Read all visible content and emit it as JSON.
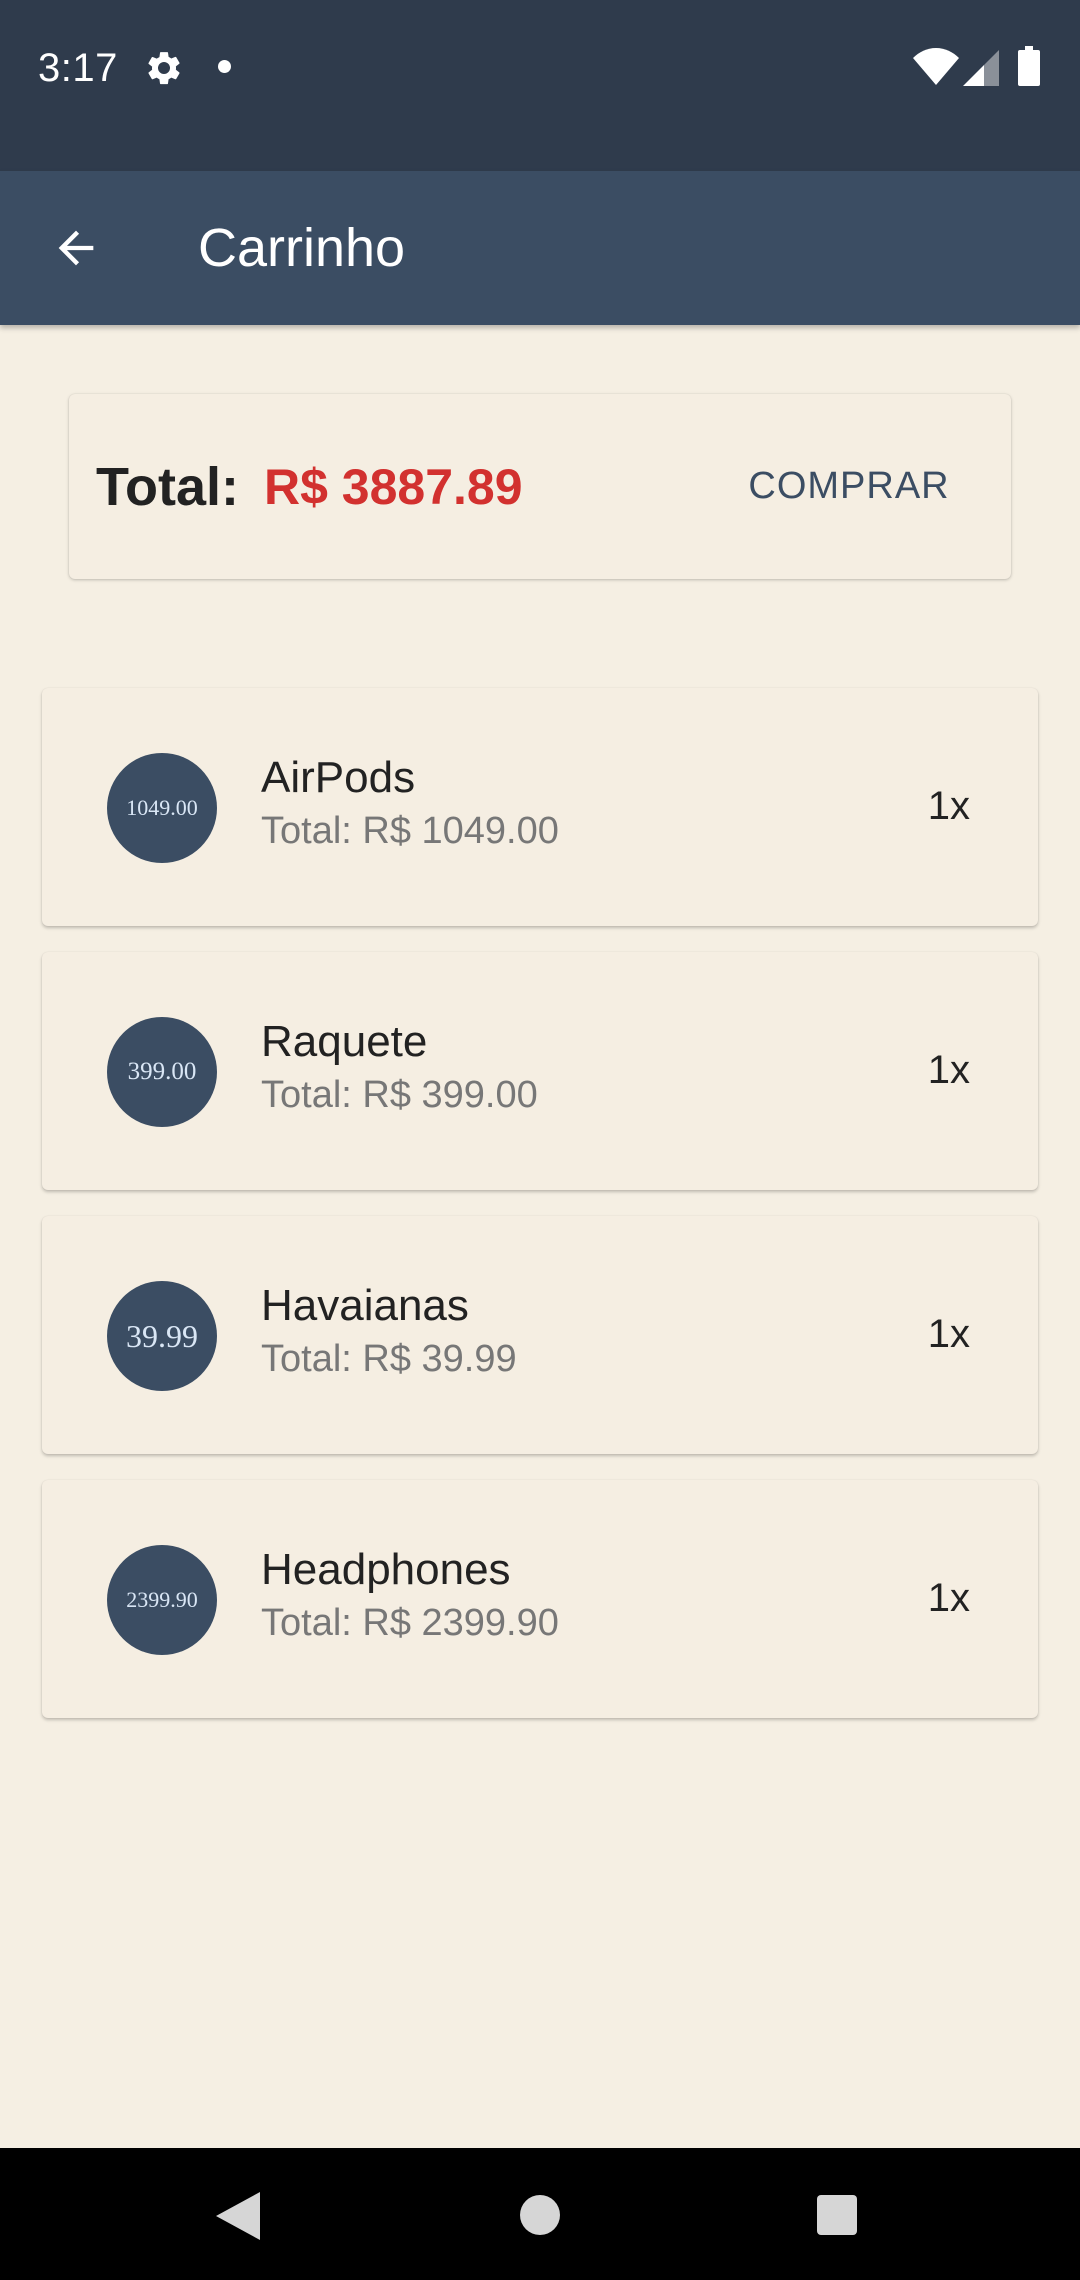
{
  "status_bar": {
    "time": "3:17",
    "icons": [
      "gear-icon",
      "notification-dot-icon",
      "wifi-icon",
      "signal-icon",
      "battery-icon"
    ]
  },
  "app_bar": {
    "title": "Carrinho",
    "back_icon": "arrow-left-icon"
  },
  "summary": {
    "total_label": "Total:",
    "total_value": "R$ 3887.89",
    "buy_label": "COMPRAR"
  },
  "items": [
    {
      "avatar_text": "1049.00",
      "name": "AirPods",
      "total": "Total: R$ 1049.00",
      "qty": "1x"
    },
    {
      "avatar_text": "399.00",
      "name": "Raquete",
      "total": "Total: R$ 399.00",
      "qty": "1x"
    },
    {
      "avatar_text": "39.99",
      "name": "Havaianas",
      "total": "Total: R$ 39.99",
      "qty": "1x"
    },
    {
      "avatar_text": "2399.90",
      "name": "Headphones",
      "total": "Total: R$ 2399.90",
      "qty": "1x"
    }
  ],
  "nav_bar": {
    "icons": [
      "back-triangle-icon",
      "home-circle-icon",
      "recents-square-icon"
    ]
  },
  "colors": {
    "status_bar": "#2f3b4c",
    "app_bar": "#3b4d63",
    "background": "#f5efe3",
    "total_value": "#d2312f",
    "avatar": "#3b4d63"
  }
}
